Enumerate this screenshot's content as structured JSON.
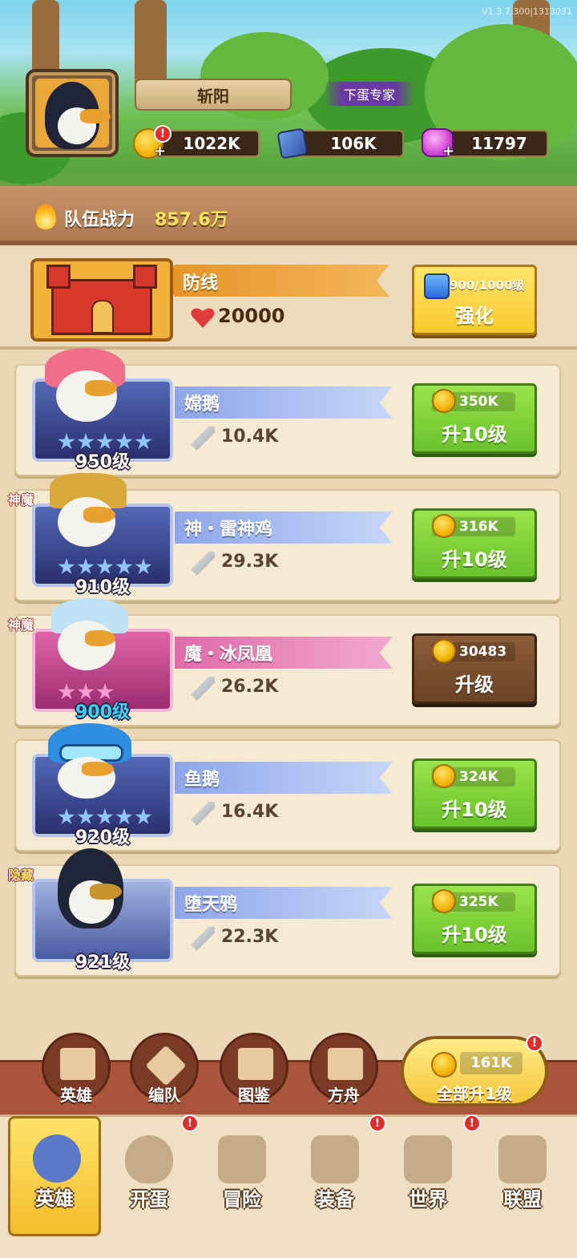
{
  "version": "V1.3.7.300|1313031",
  "player": {
    "name": "斩阳",
    "title": "下蛋专家"
  },
  "resources": {
    "gold": "1022K",
    "blue_gem": "106K",
    "pink_gem": "11797"
  },
  "team_power": {
    "label": "队伍战力",
    "value": "857.6万"
  },
  "defense": {
    "name": "防线",
    "hp": "20000",
    "level": "900/1000级",
    "button": "强化"
  },
  "heroes": [
    {
      "name": "嫦鹅",
      "power": "10.4K",
      "level": "950级",
      "tag": "",
      "stars": 5,
      "cost": "350K",
      "button": "升10级",
      "style": "blue"
    },
    {
      "name": "神・雷神鸡",
      "power": "29.3K",
      "level": "910级",
      "tag": "神魔",
      "stars": 5,
      "cost": "316K",
      "button": "升10级",
      "style": "blue"
    },
    {
      "name": "魔・冰凤凰",
      "power": "26.2K",
      "level": "900级",
      "tag": "神魔",
      "stars": 3,
      "cost": "30483",
      "button": "升级",
      "style": "pink"
    },
    {
      "name": "鱼鹅",
      "power": "16.4K",
      "level": "920级",
      "tag": "",
      "stars": 5,
      "cost": "324K",
      "button": "升10级",
      "style": "blue"
    },
    {
      "name": "堕天鸦",
      "power": "22.3K",
      "level": "921级",
      "tag": "隐藏",
      "stars": 0,
      "cost": "325K",
      "button": "升10级",
      "style": "blue"
    }
  ],
  "action_bar": {
    "buttons": [
      "英雄",
      "编队",
      "图鉴",
      "方舟"
    ],
    "upgrade_all": {
      "cost": "161K",
      "label": "全部升1级"
    }
  },
  "tabs": [
    "英雄",
    "开蛋",
    "冒险",
    "装备",
    "世界",
    "联盟"
  ],
  "colors": {
    "green_button": "#69c22b",
    "brown_button": "#6b4327",
    "active_tab": "#f3be2a",
    "power_value": "#ffe35a"
  }
}
